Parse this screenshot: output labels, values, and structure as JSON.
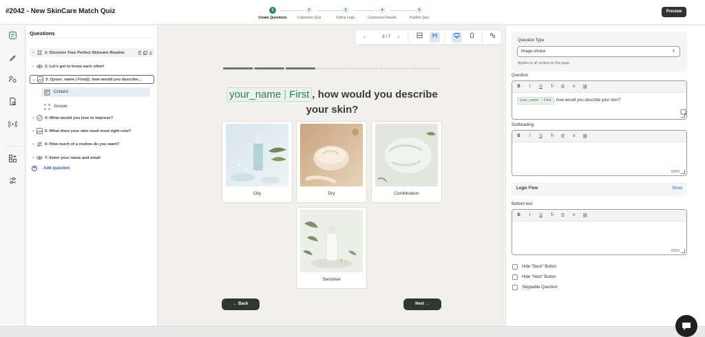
{
  "app": {
    "title": "#2042 - New SkinCare Match Quiz",
    "preview_label": "Preview"
  },
  "steps": [
    {
      "num": "1",
      "label": "Create Questions",
      "active": true
    },
    {
      "num": "2",
      "label": "Customize Quiz",
      "active": false
    },
    {
      "num": "3",
      "label": "Define Logic",
      "active": false
    },
    {
      "num": "4",
      "label": "Customize Results",
      "active": false
    },
    {
      "num": "5",
      "label": "Publish Quiz",
      "active": false
    }
  ],
  "rail_icons": [
    "questions-icon",
    "brush-icon",
    "users-icon",
    "document-icon",
    "broadcast-icon",
    "apps-icon",
    "sliders-icon"
  ],
  "questions_panel": {
    "title": "Questions",
    "items": [
      {
        "label": "1: Discover Your Perfect Skincare Routine",
        "icon": "intro-icon"
      },
      {
        "label": "2: Let's get to know each other!",
        "icon": "eye-icon"
      },
      {
        "label": "3: {{your_name | First}}, how would you describe...",
        "icon": "image-choice-icon"
      },
      {
        "label": "4: What would you love to improve?",
        "icon": "check-circle-icon"
      },
      {
        "label": "5: What does your skin need most right now?",
        "icon": "image-choice-icon"
      },
      {
        "label": "6: How much of a routine do you want?",
        "icon": "slider-icon"
      },
      {
        "label": "7: Enter your name and email",
        "icon": "eye-icon"
      }
    ],
    "sub_items": [
      {
        "label": "Content"
      },
      {
        "label": "Answer"
      }
    ],
    "add_label": "Add question"
  },
  "canvas": {
    "page_indicator": "3 / 7",
    "progress": {
      "total": 7,
      "done": 3
    },
    "heading": {
      "token_name": "your_name",
      "token_modifier": "First",
      "rest": ", how would you describe your skin?"
    },
    "choices": [
      {
        "label": "Oily"
      },
      {
        "label": "Dry"
      },
      {
        "label": "Combination"
      },
      {
        "label": "Sensitive"
      }
    ],
    "back_label": "← Back",
    "next_label": "Next →"
  },
  "settings": {
    "question_type_label": "Question Type",
    "question_type_value": "image choice",
    "applies_hint": "Applies to all content on this page.",
    "question_label": "Question",
    "question_token_name": "your_name",
    "question_token_modifier": "First",
    "question_rest": ", how would you describe your skin?",
    "subheading_label": "Subheading",
    "subheading_count": "0/500",
    "logic_flow_label": "Logic Flow",
    "logic_flow_action": "Show",
    "bottom_text_label": "Bottom text",
    "bottom_text_count": "0/500",
    "toolbar": [
      "B",
      "I",
      "U",
      "T",
      "list",
      "ordered-list",
      "link"
    ],
    "checkboxes": [
      {
        "label": "Hide \"Back\" Button"
      },
      {
        "label": "Hide \"Next\" Button"
      },
      {
        "label": "Skippable Question"
      }
    ]
  },
  "colors": {
    "accent": "#2e8a57",
    "link": "#2c5fc4",
    "button_dark": "#2f3733"
  }
}
